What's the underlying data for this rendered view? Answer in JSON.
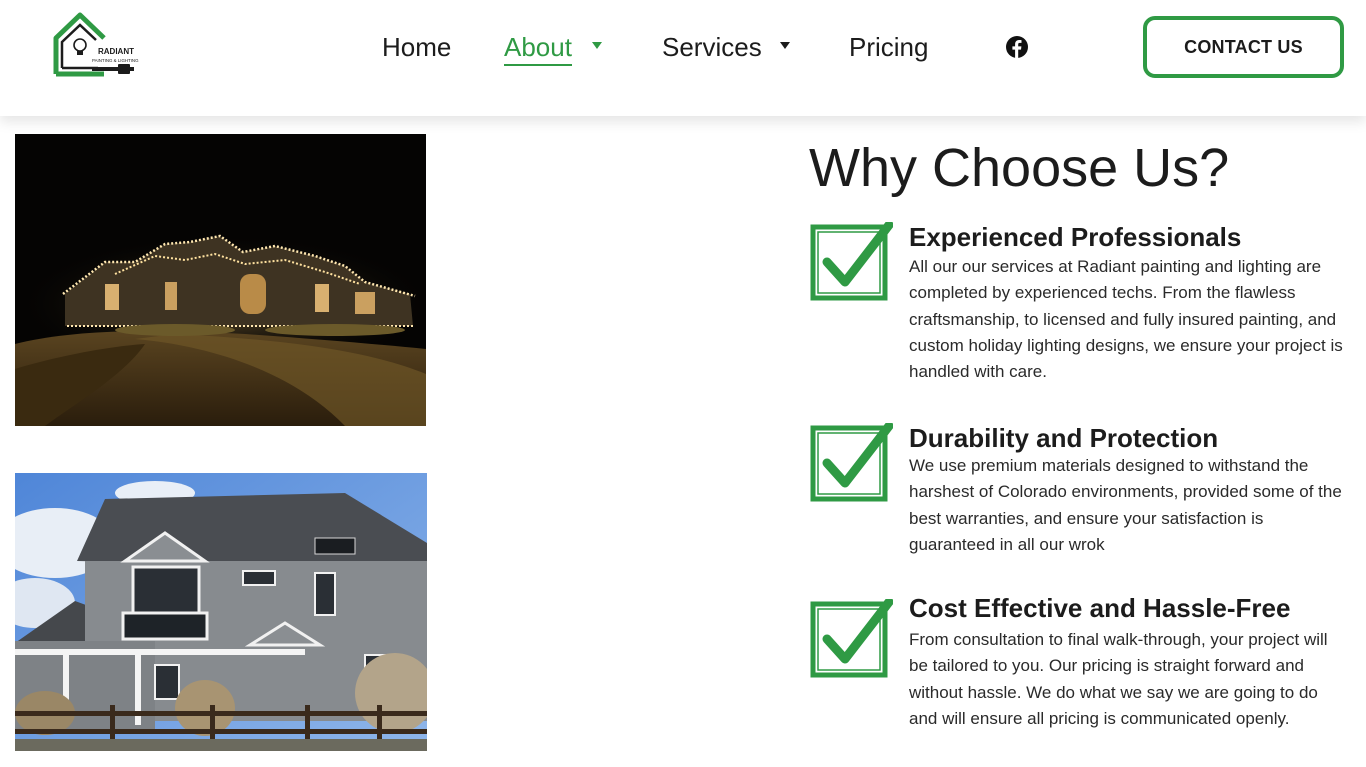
{
  "brand": {
    "name": "RADIANT",
    "tagline": "PAINTING & LIGHTING",
    "accent_color": "#2f9a44"
  },
  "nav": {
    "items": [
      {
        "label": "Home",
        "has_dropdown": false,
        "active": false
      },
      {
        "label": "About",
        "has_dropdown": true,
        "active": true
      },
      {
        "label": "Services",
        "has_dropdown": true,
        "active": false
      },
      {
        "label": "Pricing",
        "has_dropdown": false,
        "active": false
      }
    ],
    "social_icon": "facebook-icon",
    "cta_label": "CONTACT US"
  },
  "images": {
    "night_house": "house-with-holiday-lights-photo",
    "day_house": "gray-two-story-house-photo"
  },
  "why": {
    "title": "Why Choose Us?",
    "features": [
      {
        "icon": "green-checkbox-icon",
        "title": "Experienced Professionals",
        "text": "All our our services at Radiant painting and lighting are completed by experienced techs. From the flawless craftsmanship, to licensed and fully insured painting, and custom holiday lighting designs, we ensure your project is handled with care."
      },
      {
        "icon": "green-checkbox-icon",
        "title": "Durability and Protection",
        "text": "We use premium materials designed to withstand the harshest of Colorado environments, provided some of the best warranties, and ensure your satisfaction is guaranteed in all our wrok"
      },
      {
        "icon": "green-checkbox-icon",
        "title": "Cost Effective and Hassle-Free",
        "text": "From consultation to final walk-through, your project will be tailored to you. Our pricing is straight forward and without hassle. We do what we say we are going to do and will ensure all pricing is communicated openly."
      }
    ]
  }
}
